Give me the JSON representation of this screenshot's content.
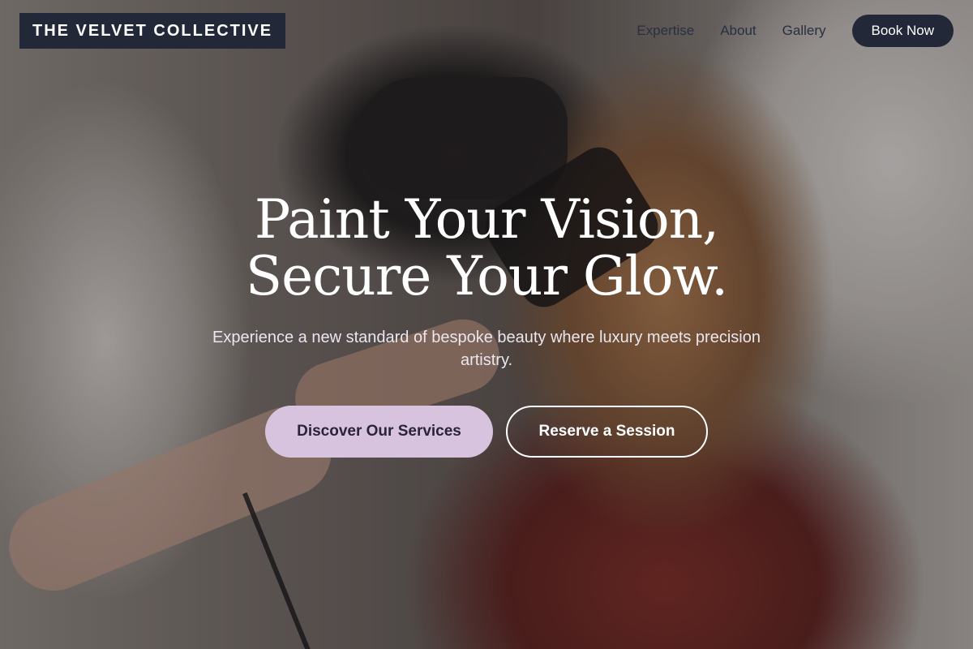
{
  "brand": {
    "name": "THE VELVET COLLECTIVE"
  },
  "nav": {
    "items": [
      {
        "label": "Expertise"
      },
      {
        "label": "About"
      },
      {
        "label": "Gallery"
      }
    ],
    "cta_label": "Book Now"
  },
  "hero": {
    "headline_line1": "Paint Your Vision,",
    "headline_line2": "Secure Your Glow.",
    "subtitle": "Experience a new standard of bespoke beauty where luxury meets precision artistry.",
    "primary_cta": "Discover Our Services",
    "secondary_cta": "Reserve a Session"
  },
  "colors": {
    "navy": "#232839",
    "lilac": "#d8c3df",
    "white": "#ffffff"
  }
}
